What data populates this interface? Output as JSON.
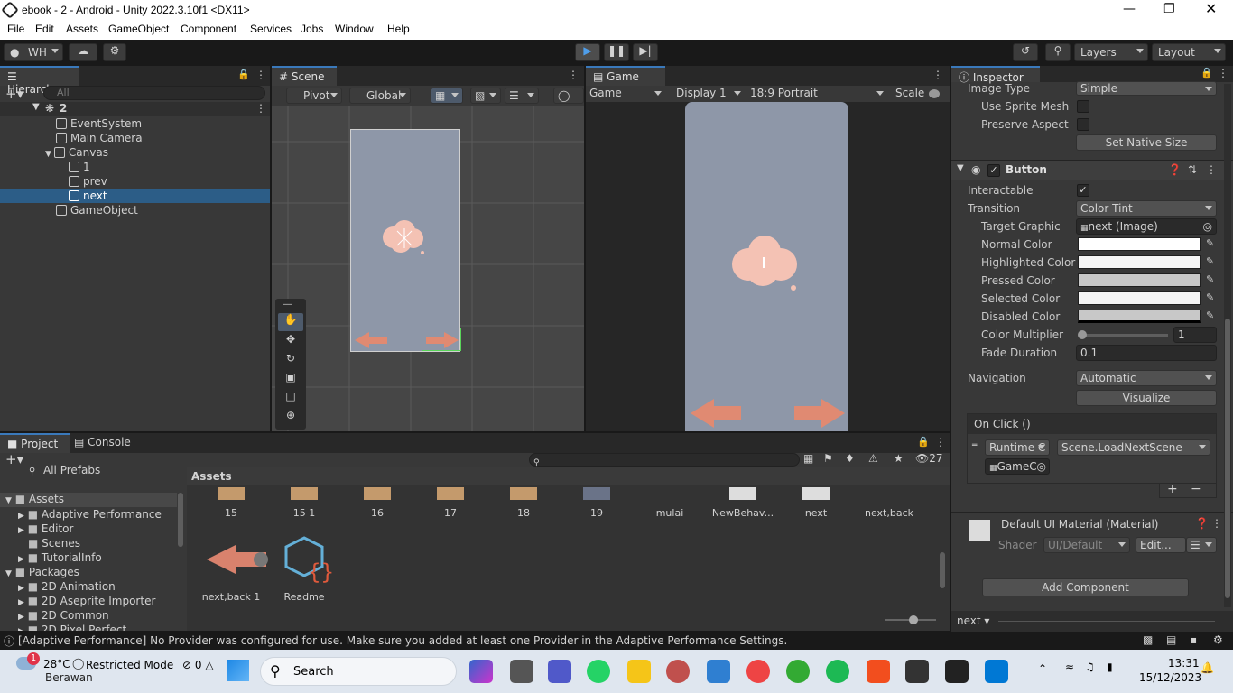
{
  "window": {
    "title": "ebook - 2 - Android - Unity 2022.3.10f1 <DX11>"
  },
  "menu": [
    "File",
    "Edit",
    "Assets",
    "GameObject",
    "Component",
    "Services",
    "Jobs",
    "Window",
    "Help"
  ],
  "toolbar": {
    "account": "WH",
    "layers": "Layers",
    "layout": "Layout"
  },
  "hierarchy": {
    "tab": "Hierarchy",
    "search_placeholder": "All",
    "scene": "2",
    "items": [
      "EventSystem",
      "Main Camera",
      "Canvas",
      "1",
      "prev",
      "next",
      "GameObject"
    ]
  },
  "scene": {
    "tab": "Scene",
    "pivot": "Pivot",
    "global": "Global"
  },
  "game": {
    "tab": "Game",
    "mode": "Game",
    "display": "Display 1",
    "aspect": "18:9 Portrait",
    "scale": "Scale"
  },
  "inspector": {
    "tab": "Inspector",
    "image_type_label": "Image Type",
    "image_type": "Simple",
    "use_sprite_mesh": "Use Sprite Mesh",
    "preserve_aspect": "Preserve Aspect",
    "set_native_size": "Set Native Size",
    "component": "Button",
    "interactable": "Interactable",
    "transition_label": "Transition",
    "transition": "Color Tint",
    "target_graphic_label": "Target Graphic",
    "target_graphic": "next (Image)",
    "normal_color": "Normal Color",
    "highlighted_color": "Highlighted Color",
    "pressed_color": "Pressed Color",
    "selected_color": "Selected Color",
    "disabled_color": "Disabled Color",
    "color_multiplier_label": "Color Multiplier",
    "color_multiplier": "1",
    "fade_duration_label": "Fade Duration",
    "fade_duration": "0.1",
    "navigation_label": "Navigation",
    "navigation": "Automatic",
    "visualize": "Visualize",
    "on_click": "On Click ()",
    "runtime": "Runtime C",
    "function": "Scene.LoadNextScene",
    "target_object": "GameC",
    "material": "Default UI Material (Material)",
    "shader_label": "Shader",
    "shader": "UI/Default",
    "edit": "Edit...",
    "add_component": "Add Component",
    "footer_object": "next"
  },
  "project": {
    "tab": "Project",
    "console_tab": "Console",
    "count": "27",
    "favorites_item": "All Prefabs",
    "tree": [
      {
        "label": "Assets",
        "level": 0
      },
      {
        "label": "Adaptive Performance",
        "level": 1
      },
      {
        "label": "Editor",
        "level": 1
      },
      {
        "label": "Scenes",
        "level": 1
      },
      {
        "label": "TutorialInfo",
        "level": 1
      },
      {
        "label": "Packages",
        "level": 0
      },
      {
        "label": "2D Animation",
        "level": 1
      },
      {
        "label": "2D Aseprite Importer",
        "level": 1
      },
      {
        "label": "2D Common",
        "level": 1
      },
      {
        "label": "2D Pixel Perfect",
        "level": 1
      }
    ],
    "breadcrumb": "Assets",
    "assets_row1": [
      "15",
      "15 1",
      "16",
      "17",
      "18",
      "19",
      "mulai",
      "NewBehav...",
      "next",
      "next,back"
    ],
    "assets_row2": [
      "next,back 1",
      "Readme"
    ]
  },
  "status": {
    "message": "[Adaptive Performance] No Provider was configured for use. Make sure you added at least one Provider in the Adaptive Performance Settings."
  },
  "taskbar": {
    "weather_temp": "28°C",
    "weather_desc": "Berawan",
    "restricted": "Restricted Mode",
    "errors": "0",
    "warnings": "0",
    "search": "Search",
    "time": "13:31",
    "date": "15/12/2023"
  },
  "colors": {
    "accent": "#3a79bb",
    "panel": "#383838",
    "game_bg": "#8e97a8",
    "selected_row": "#2c5d87"
  }
}
